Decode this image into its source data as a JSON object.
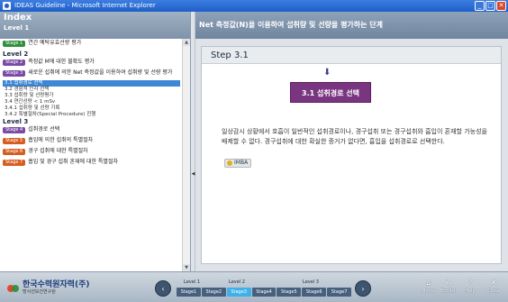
{
  "window": {
    "title": "IDEAS Guideline - Microsoft Internet Explorer",
    "buttons": [
      "_",
      "□",
      "✕"
    ]
  },
  "index": {
    "title": "Index",
    "level1": "Level 1",
    "level2": "Level 2",
    "level3": "Level 3",
    "items": [
      {
        "badge": "Stage 1",
        "label": "연간 예탁유효선량 평가",
        "color": "#2f8f3a"
      },
      {
        "badge": "Stage 2",
        "label": "측정값 M에 대한 불확도 평가",
        "color": "#7b4aa6"
      },
      {
        "badge": "Stage 3",
        "label": "새로운 섭취에 의한 Net 측정값을 이용하여 섭취량 및 선량 평가",
        "color": "#7b4aa6"
      }
    ],
    "subitems": [
      "3.1  섭취경로 선택",
      "3.2  경험적 인자 선택",
      "3.3  섭취량 및 선량평가",
      "3.4  연간선량 < 1 mSv",
      "3.4.1 섭취량 및 선량 기록",
      "3.4.2 특별절차(Special Procedure) 진행"
    ],
    "active_sub": 0,
    "items3": [
      {
        "badge": "Stage 4",
        "label": "섭취경로 선택",
        "color": "#7b4aa6"
      },
      {
        "badge": "Stage 5",
        "label": "흡입에 의한 섭취의 특별절차",
        "color": "#d65c1f"
      },
      {
        "badge": "Stage 6",
        "label": "경구 섭취에 대한 특별절차",
        "color": "#d65c1f"
      },
      {
        "badge": "Stage 7",
        "label": "흡입 및 경구 섭취 혼재에 대한 특별절차",
        "color": "#d65c1f"
      }
    ]
  },
  "main": {
    "header": "Net 측정값(N)을 이용하여 섭취량 및 선량을 평가하는 단계",
    "step": "Step 3.1",
    "box_title": "3.1 섭취경로 선택",
    "body": "일상감시 상황에서 호흡이 일반적인 섭취경로이나, 경구섭취 또는 경구섭취와 흡입이 혼재할 가능성을 배제할 수 없다. 경구섭취에 대한 확실한 증거가 없다면, 흡입을 섭취경로로 선택한다.",
    "link": "IMBA"
  },
  "footer": {
    "logo": "한국수력원자력(주)",
    "logo_sub": "방사선보건연구원",
    "levels": [
      "Level 1",
      "Level 2",
      "Level 3"
    ],
    "stages": [
      "Stage1",
      "Stage2",
      "Stage3",
      "Stage4",
      "Stage5",
      "Stage6",
      "Stage7"
    ],
    "active_stage": 2,
    "utils": [
      {
        "label": "Home",
        "icon": "home-icon",
        "glyph": "⌂"
      },
      {
        "label": "English",
        "icon": "language-icon",
        "glyph": "A"
      },
      {
        "label": "Help",
        "icon": "help-icon",
        "glyph": "?"
      },
      {
        "label": "Close",
        "icon": "close-icon",
        "glyph": "✕"
      }
    ]
  }
}
